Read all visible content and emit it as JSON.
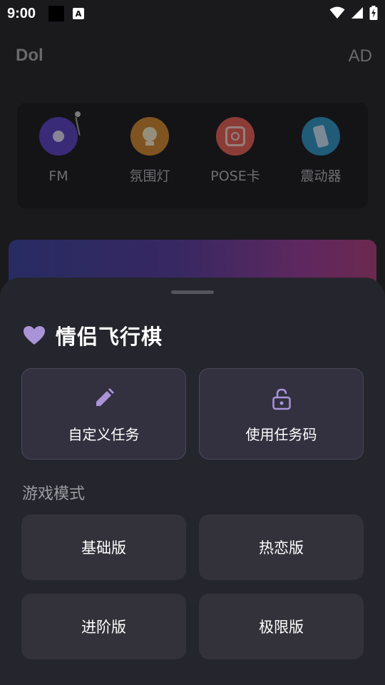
{
  "status_bar": {
    "time": "9:00",
    "notification_letter": "A"
  },
  "header": {
    "logo": "Dol",
    "ad_label": "AD"
  },
  "features": [
    {
      "label": "FM",
      "icon": "vinyl-record-icon",
      "color": "#6a3fd6"
    },
    {
      "label": "氛围灯",
      "icon": "bulb-icon",
      "color": "#e08a2c"
    },
    {
      "label": "POSE卡",
      "icon": "camera-icon",
      "color": "#f06a5a"
    },
    {
      "label": "震动器",
      "icon": "vibrate-icon",
      "color": "#2a9fd6"
    }
  ],
  "sheet": {
    "title": "情侣飞行棋",
    "title_icon": "heart-icon",
    "actions": [
      {
        "label": "自定义任务",
        "icon": "pencil-icon"
      },
      {
        "label": "使用任务码",
        "icon": "lock-icon"
      }
    ],
    "mode_header": "游戏模式",
    "modes": [
      {
        "label": "基础版"
      },
      {
        "label": "热恋版"
      },
      {
        "label": "进阶版"
      },
      {
        "label": "极限版"
      }
    ]
  },
  "colors": {
    "accent": "#a994d8",
    "sheet_bg": "#25252d",
    "card_bg": "#33303f"
  }
}
